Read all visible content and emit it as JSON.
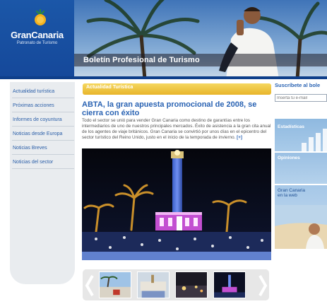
{
  "brand": {
    "name": "GranCanaria",
    "tagline": "Patronato de Turismo"
  },
  "header": {
    "banner_title": "Boletín Profesional de Turismo"
  },
  "nav": {
    "items": [
      {
        "label": "Actualidad turística"
      },
      {
        "label": "Próximas acciones"
      },
      {
        "label": "Informes de coyuntura"
      },
      {
        "label": "Noticias desde Europa"
      },
      {
        "label": "Noticias Breves"
      },
      {
        "label": "Noticias del sector"
      }
    ]
  },
  "section": {
    "label": "Actualidad Turística"
  },
  "article": {
    "title": "ABTA, la gran apuesta promocional de 2008, se cierra con éxito",
    "body": "Todo el sector se unió para vender Gran Canaria como destino de garantías entre los intermediarios de uno de nuestros principales mercados. Éxito de asistencia a la gran cita anual de los agentes de viaje británicos. Gran Canaria se convirtió por unos días en el epicentro del sector turístico del Reino Unido, justo en el inicio de la temporada de invierno.",
    "more": "[+]"
  },
  "sidebar": {
    "subscribe_title": "Suscríbete al bole",
    "email_placeholder": "Inserta tu e-mail",
    "stats_label": "Estadísticas",
    "opinions_label": "Opiniones",
    "web_label_line1": "Gran Canaria",
    "web_label_line2": "en la web"
  },
  "colors": {
    "brand_blue": "#1b57a8",
    "link_blue": "#2a63b3",
    "section_yellow": "#e8b52a",
    "nav_bg": "#e9ecef"
  },
  "icons": {
    "logo": "sun-pineapple-icon",
    "prev": "chevron-left-icon",
    "next": "chevron-right-icon"
  }
}
